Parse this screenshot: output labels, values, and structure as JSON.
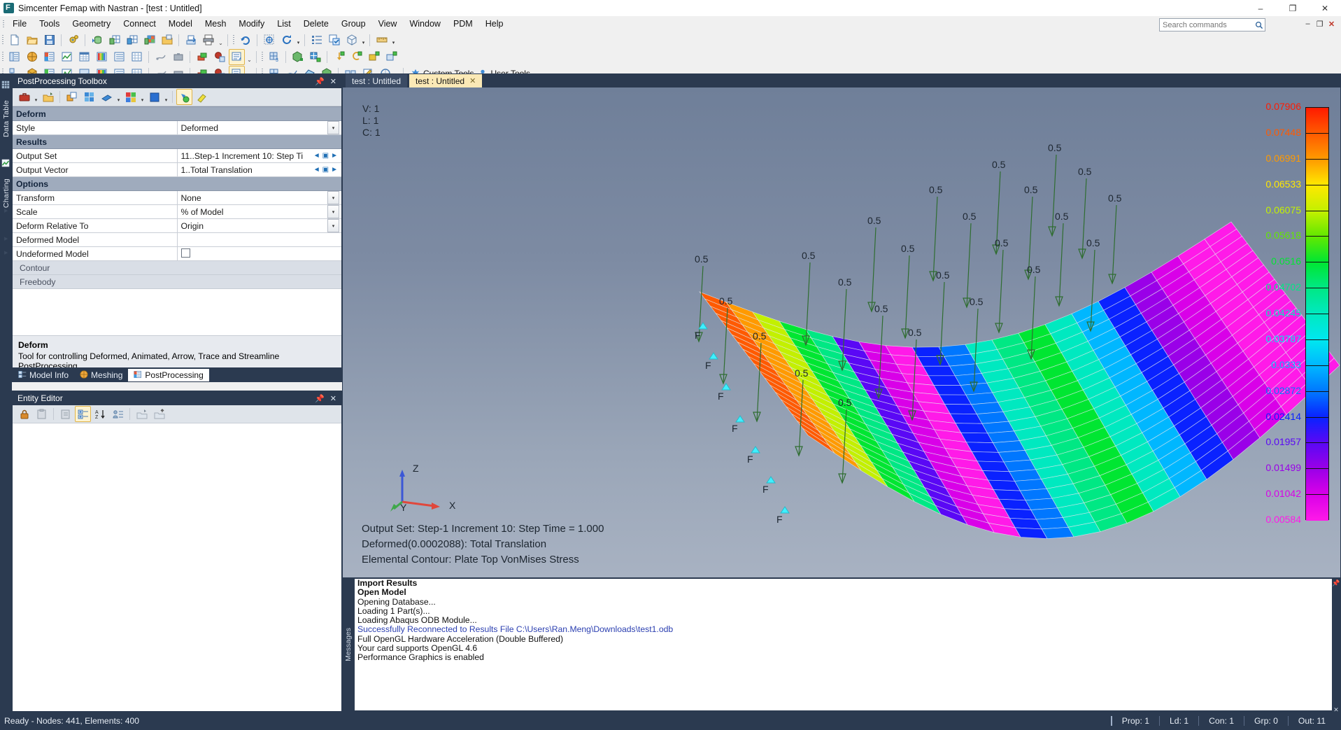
{
  "window": {
    "title": "Simcenter Femap with Nastran - [test : Untitled]",
    "logo_icon": "femap-logo-icon",
    "minimize": "–",
    "maximize": "❐",
    "close": "✕"
  },
  "menu": {
    "items": [
      "File",
      "Tools",
      "Geometry",
      "Connect",
      "Model",
      "Mesh",
      "Modify",
      "List",
      "Delete",
      "Group",
      "View",
      "Window",
      "PDM",
      "Help"
    ],
    "search_placeholder": "Search commands",
    "search_value": "",
    "search_icon": "search-icon",
    "mdi_restore": "❐",
    "mdi_minimize": "–",
    "mdi_close": "✕"
  },
  "toolbars": {
    "custom_tools_label": "Custom Tools",
    "user_tools_label": "User Tools",
    "overflow": "≡"
  },
  "left_dock": {
    "tabs": [
      {
        "label": "Data Table",
        "icon": "data-table-icon"
      },
      {
        "label": "Charting",
        "icon": "charting-icon"
      }
    ]
  },
  "postprocessing": {
    "title": "PostProcessing Toolbox",
    "pin_icon": "pin-icon",
    "close_icon": "close-icon",
    "groups": [
      {
        "type": "group",
        "label": "Deform"
      },
      {
        "type": "row",
        "label": "Style",
        "value": "Deformed",
        "control": "dropdown"
      },
      {
        "type": "subgroup",
        "label": "Results"
      },
      {
        "type": "row",
        "label": "Output Set",
        "value": "11..Step-1 Increment     10: Step Ti",
        "control": "spinner"
      },
      {
        "type": "row",
        "label": "Output Vector",
        "value": "1..Total Translation",
        "control": "spinner"
      },
      {
        "type": "subgroup",
        "label": "Options"
      },
      {
        "type": "row",
        "label": "Transform",
        "value": "None",
        "control": "dropdown"
      },
      {
        "type": "row",
        "label": "Scale",
        "value": "% of Model",
        "control": "dropdown",
        "expandable": true
      },
      {
        "type": "row",
        "label": "Deform Relative To",
        "value": "Origin",
        "control": "dropdown"
      },
      {
        "type": "row",
        "label": "Deformed Model",
        "value": "",
        "control": "none",
        "expandable": true
      },
      {
        "type": "row",
        "label": "Undeformed Model",
        "value": "",
        "control": "checkbox",
        "checked": false,
        "expandable": true
      }
    ],
    "sections": [
      "Contour",
      "Freebody"
    ],
    "help_title": "Deform",
    "help_text": "Tool for controlling Deformed, Animated, Arrow, Trace and Streamline PostProcessing.",
    "tabs": [
      {
        "label": "Model Info",
        "icon": "model-info-icon",
        "active": false
      },
      {
        "label": "Meshing",
        "icon": "meshing-icon",
        "active": false
      },
      {
        "label": "PostProcessing",
        "icon": "postprocessing-icon",
        "active": true
      }
    ]
  },
  "entity_editor": {
    "title": "Entity Editor",
    "pin_icon": "pin-icon",
    "close_icon": "close-icon",
    "toolbar_icons": [
      "lock-icon",
      "paste-icon",
      "copy-properties-icon",
      "categorized-icon",
      "sort-alpha-icon",
      "group-icon",
      "load-icon",
      "save-icon"
    ]
  },
  "document_tabs": [
    {
      "label": "test : Untitled",
      "active": false,
      "closeable": false
    },
    {
      "label": "test : Untitled",
      "active": true,
      "closeable": true,
      "close": "✕"
    }
  ],
  "viewport": {
    "view_info": [
      "V: 1",
      "L: 1",
      "C: 1"
    ],
    "footer_lines": [
      "Output Set: Step-1 Increment    10: Step Time =   1.000",
      "Deformed(0.0002088): Total Translation",
      "Elemental Contour: Plate Top VonMises Stress"
    ],
    "triad": {
      "x": "X",
      "y": "Y",
      "z": "Z"
    },
    "load_label": "0.5",
    "constraint_label": "F",
    "load_count": 24,
    "constraint_count": 7
  },
  "chart_data": {
    "type": "heatmap",
    "title": "Elemental Contour: Plate Top VonMises Stress",
    "ylabel": "VonMises Stress",
    "legend_position": "right",
    "levels": [
      {
        "value": "0.07906",
        "color": "#ff1a00"
      },
      {
        "value": "0.07448",
        "color": "#ff5a00"
      },
      {
        "value": "0.06991",
        "color": "#ff9a00"
      },
      {
        "value": "0.06533",
        "color": "#ffe800"
      },
      {
        "value": "0.06075",
        "color": "#c3f000"
      },
      {
        "value": "0.05618",
        "color": "#63e800"
      },
      {
        "value": "0.0516",
        "color": "#00e632"
      },
      {
        "value": "0.04702",
        "color": "#00e884"
      },
      {
        "value": "0.04245",
        "color": "#00e9c0"
      },
      {
        "value": "0.03787",
        "color": "#00e8ef"
      },
      {
        "value": "0.0333",
        "color": "#00b7ff"
      },
      {
        "value": "0.02872",
        "color": "#0077ff"
      },
      {
        "value": "0.02414",
        "color": "#0a22ff"
      },
      {
        "value": "0.01957",
        "color": "#5a08f5"
      },
      {
        "value": "0.01499",
        "color": "#9a00e8"
      },
      {
        "value": "0.01042",
        "color": "#d900e8"
      },
      {
        "value": "0.00584",
        "color": "#ff1ae8"
      }
    ]
  },
  "messages": {
    "tab_label": "Messages",
    "lines": [
      {
        "text": "Import Results",
        "bold": true,
        "color": "black"
      },
      {
        "text": "Open Model",
        "bold": true,
        "color": "black"
      },
      {
        "text": "Opening Database...",
        "bold": false,
        "color": "black"
      },
      {
        "text": "Loading 1 Part(s)...",
        "bold": false,
        "color": "black"
      },
      {
        "text": "Loading Abaqus ODB Module...",
        "bold": false,
        "color": "black"
      },
      {
        "text": "Successfully Reconnected to Results File C:\\Users\\Ran.Meng\\Downloads\\test1.odb",
        "bold": false,
        "color": "blue"
      },
      {
        "text": "Full OpenGL Hardware Acceleration (Double Buffered)",
        "bold": false,
        "color": "black"
      },
      {
        "text": "Your card supports OpenGL 4.6",
        "bold": false,
        "color": "black"
      },
      {
        "text": "Performance Graphics is enabled",
        "bold": false,
        "color": "black"
      }
    ]
  },
  "status": {
    "message": "Ready - Nodes: 441,  Elements: 400",
    "cells": [
      "Prop: 1",
      "Ld: 1",
      "Con: 1",
      "Grp: 0",
      "Out: 11"
    ]
  }
}
